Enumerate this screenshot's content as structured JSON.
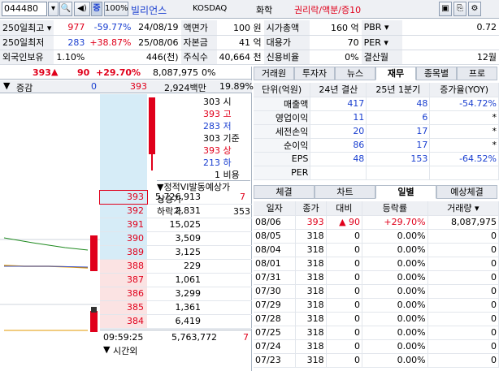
{
  "toolbar": {
    "code": "044480",
    "pct_label": "100%",
    "name": "빌리언스",
    "market": "KOSDAQ",
    "sector": "화학",
    "events": "권리락/액분/증10"
  },
  "info": {
    "rows": [
      {
        "a": "250일최고",
        "b": "977",
        "c": "-59.77%",
        "d": "24/08/19",
        "e": "액면가",
        "f": "100 원",
        "g": "시가총액",
        "h": "160 억",
        "i": "PBR",
        "j": "0.72"
      },
      {
        "a": "250일최저",
        "b": "283",
        "c": "+38.87%",
        "d": "25/08/06",
        "e": "자본금",
        "f": "41 억",
        "g": "대용가",
        "h": "70",
        "i": "PER",
        "j": ""
      },
      {
        "a": "외국인보유",
        "b": "1.10%",
        "c": "",
        "d": "446(천)",
        "e": "주식수",
        "f": "40,664 천",
        "g": "신용비율",
        "h": "0%",
        "i": "결산월",
        "j": "12월"
      }
    ]
  },
  "quote": {
    "price": "393",
    "change": "90",
    "rate": "+29.70%",
    "volume": "8,087,975",
    "vol_pct": "0%",
    "header_label": "증감",
    "header_zero": "0",
    "header_price": "393",
    "header_amount": "2,924백만",
    "header_pct": "19.89%",
    "levels": [
      {
        "v": "303",
        "k": "시"
      },
      {
        "v": "393",
        "k": "고"
      },
      {
        "v": "283",
        "k": "저"
      },
      {
        "v": "303",
        "k": "기준"
      },
      {
        "v": "393",
        "k": "상"
      },
      {
        "v": "213",
        "k": "하"
      },
      {
        "v": "1",
        "k": "비용"
      }
    ],
    "vi_label": "정적VI발동예상가",
    "upper_label": "상승가",
    "lower_label": "하락가",
    "lower_value": "353",
    "book": [
      {
        "p": "393",
        "q": "5,726,913",
        "x": "7"
      },
      {
        "p": "392",
        "q": "2,831",
        "x": ""
      },
      {
        "p": "391",
        "q": "15,025",
        "x": ""
      },
      {
        "p": "390",
        "q": "3,509",
        "x": ""
      },
      {
        "p": "389",
        "q": "3,125",
        "x": ""
      },
      {
        "p": "388",
        "q": "229",
        "x": ""
      },
      {
        "p": "387",
        "q": "1,061",
        "x": ""
      },
      {
        "p": "386",
        "q": "3,299",
        "x": ""
      },
      {
        "p": "385",
        "q": "1,361",
        "x": ""
      },
      {
        "p": "384",
        "q": "6,419",
        "x": ""
      }
    ],
    "footer_time": "09:59:25",
    "footer_total": "5,763,772",
    "footer_x": "7",
    "footer_label": "시간외"
  },
  "right_tabs": [
    "거래원",
    "투자자",
    "뉴스",
    "재무",
    "종목별",
    "프로"
  ],
  "fin": {
    "headers": [
      "단위(억원)",
      "24년 결산",
      "25년 1분기",
      "증가율(YOY)"
    ],
    "rows": [
      {
        "k": "매출액",
        "a": "417",
        "b": "48",
        "c": "-54.72%"
      },
      {
        "k": "영업이익",
        "a": "11",
        "b": "6",
        "c": "*"
      },
      {
        "k": "세전손익",
        "a": "20",
        "b": "17",
        "c": "*"
      },
      {
        "k": "순이익",
        "a": "86",
        "b": "17",
        "c": "*"
      },
      {
        "k": "EPS",
        "a": "48",
        "b": "153",
        "c": "-64.52%"
      },
      {
        "k": "PER",
        "a": "",
        "b": "",
        "c": ""
      }
    ]
  },
  "sub_tabs": [
    "체결",
    "차트",
    "일별",
    "예상체결"
  ],
  "daily": {
    "headers": [
      "일자",
      "종가",
      "대비",
      "등락률",
      "거래량"
    ],
    "rows": [
      {
        "d": "08/06",
        "c": "393",
        "x": "90",
        "r": "+29.70%",
        "v": "8,087,975"
      },
      {
        "d": "08/05",
        "c": "318",
        "x": "0",
        "r": "0.00%",
        "v": "0"
      },
      {
        "d": "08/04",
        "c": "318",
        "x": "0",
        "r": "0.00%",
        "v": "0"
      },
      {
        "d": "08/01",
        "c": "318",
        "x": "0",
        "r": "0.00%",
        "v": "0"
      },
      {
        "d": "07/31",
        "c": "318",
        "x": "0",
        "r": "0.00%",
        "v": "0"
      },
      {
        "d": "07/30",
        "c": "318",
        "x": "0",
        "r": "0.00%",
        "v": "0"
      },
      {
        "d": "07/29",
        "c": "318",
        "x": "0",
        "r": "0.00%",
        "v": "0"
      },
      {
        "d": "07/28",
        "c": "318",
        "x": "0",
        "r": "0.00%",
        "v": "0"
      },
      {
        "d": "07/25",
        "c": "318",
        "x": "0",
        "r": "0.00%",
        "v": "0"
      },
      {
        "d": "07/24",
        "c": "318",
        "x": "0",
        "r": "0.00%",
        "v": "0"
      },
      {
        "d": "07/23",
        "c": "318",
        "x": "0",
        "r": "0.00%",
        "v": "0"
      }
    ]
  }
}
